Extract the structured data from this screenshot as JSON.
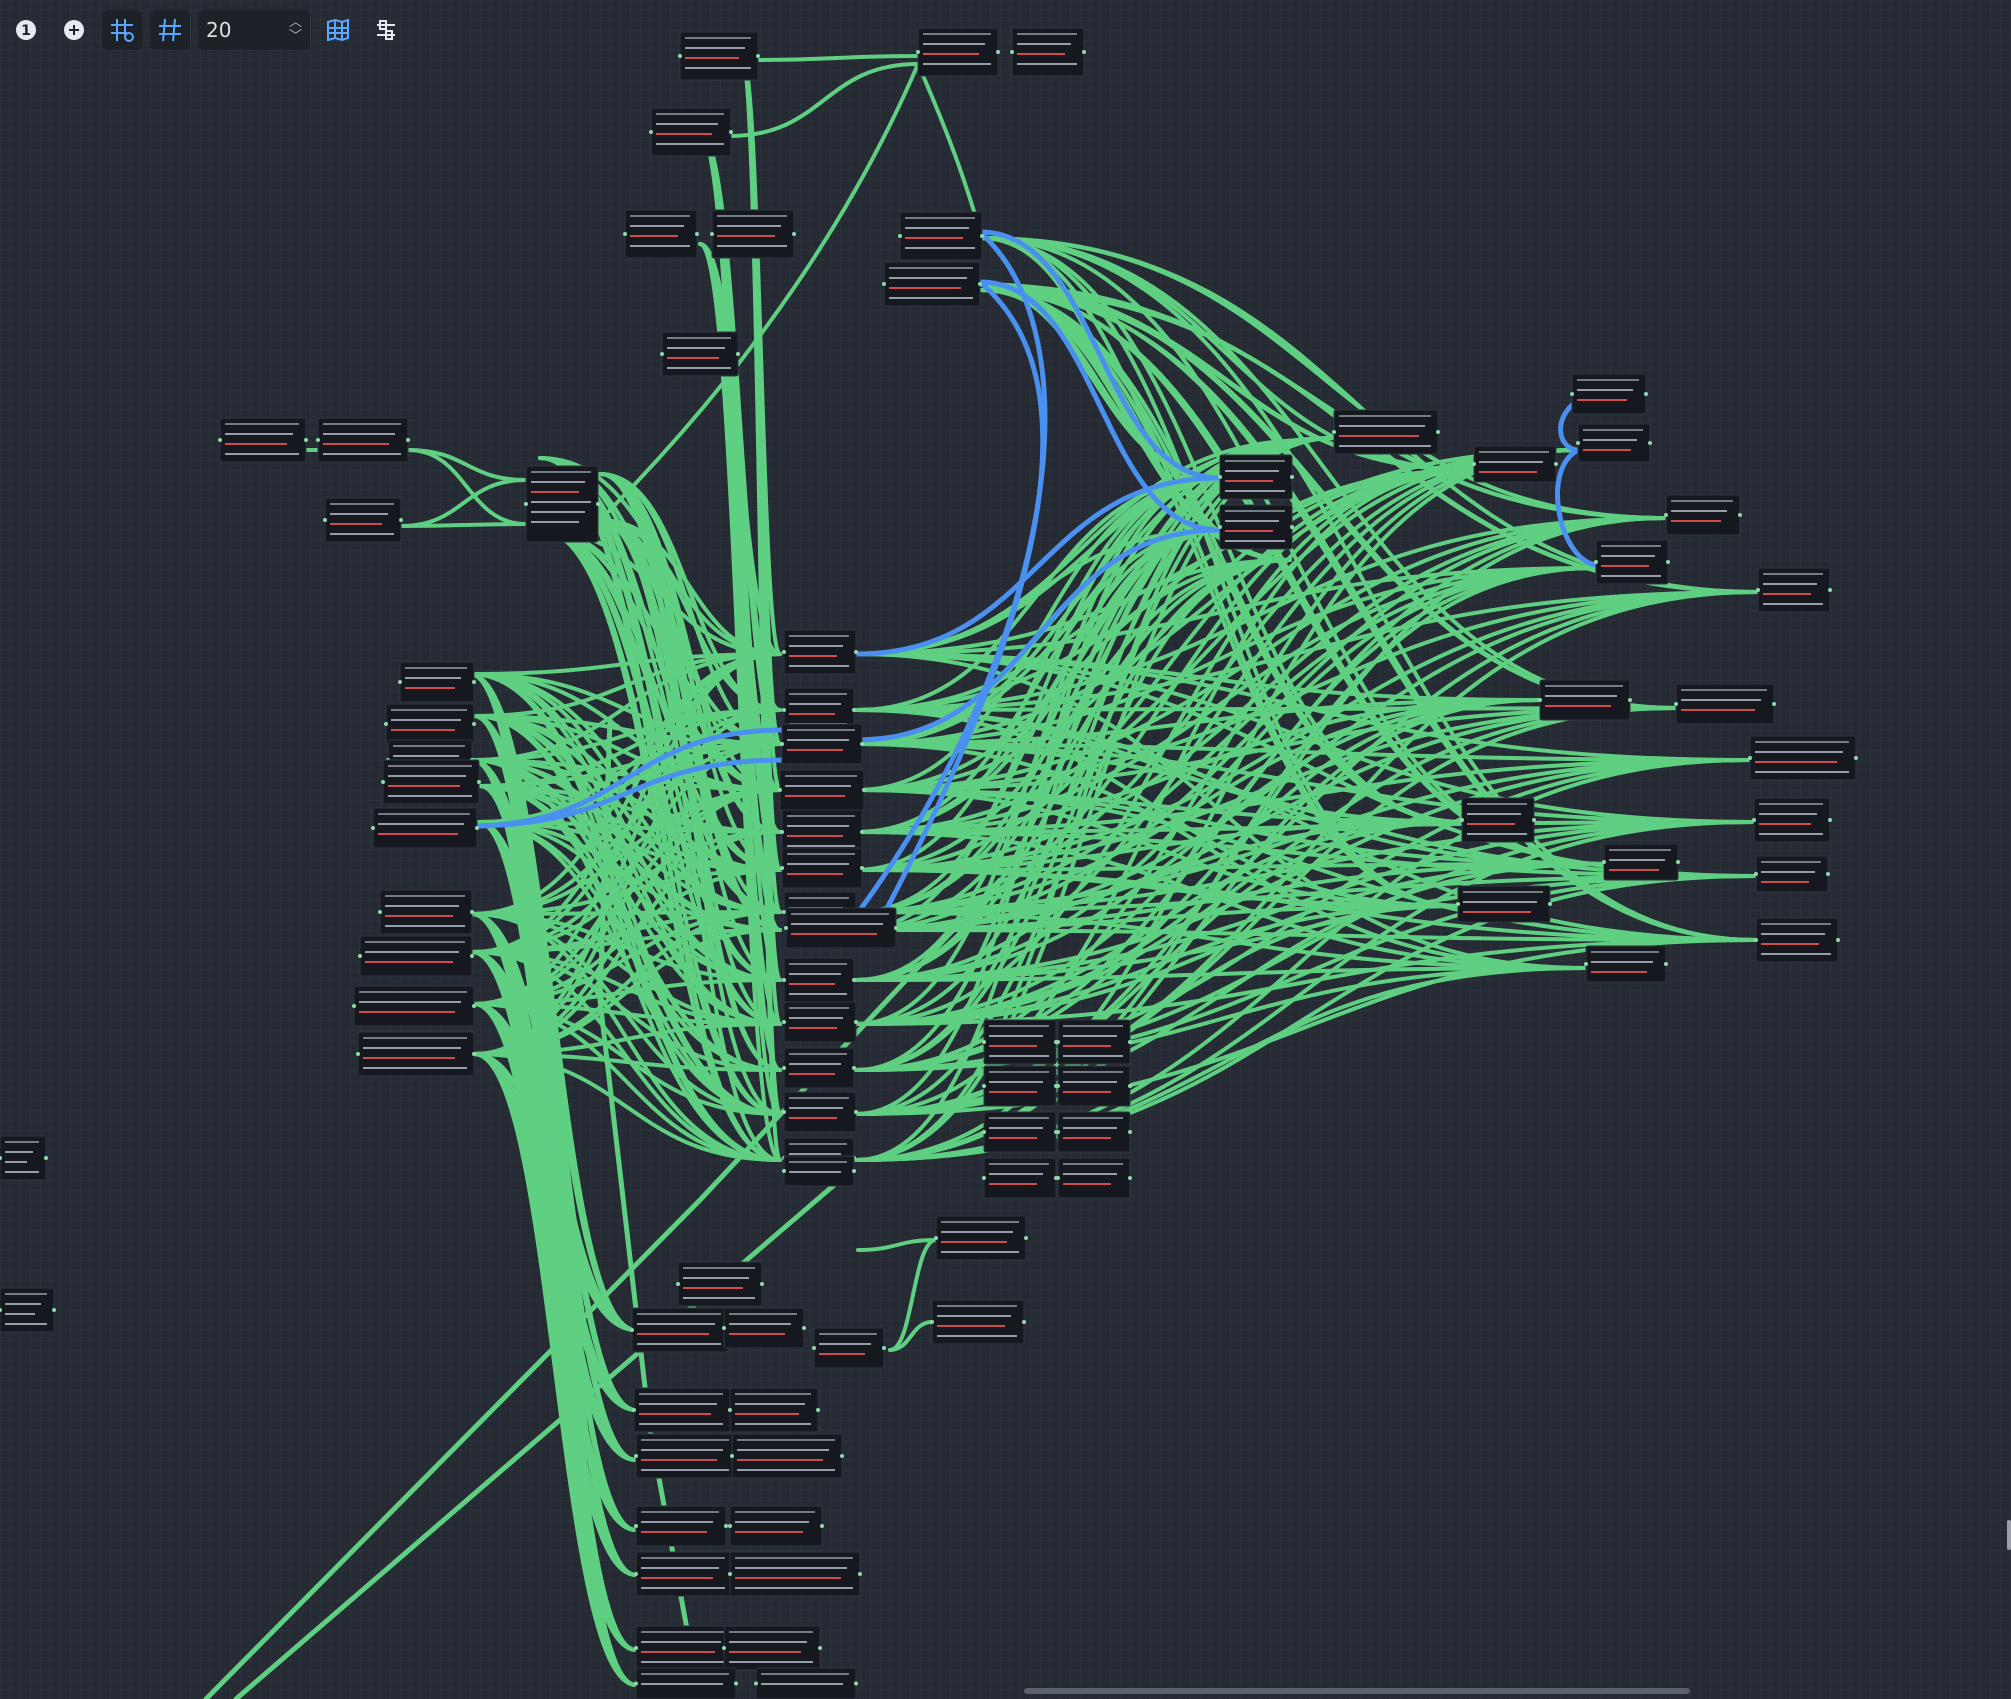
{
  "toolbar": {
    "zoom_level": "1",
    "add_symbol": "+",
    "snap_value": "20"
  },
  "colors": {
    "background": "#262b33",
    "edge_default": "#5fcf82",
    "edge_highlight": "#4a90f0",
    "node_bg": "#15191f",
    "node_text": "#b8bec8",
    "node_text_red": "#ff5a5a"
  },
  "icons": [
    "zoom-reset-icon",
    "zoom-in-icon",
    "snap-grid-icon",
    "grid-toggle-icon",
    "spinbox-arrows-icon",
    "minimap-icon",
    "arrange-icon"
  ]
}
